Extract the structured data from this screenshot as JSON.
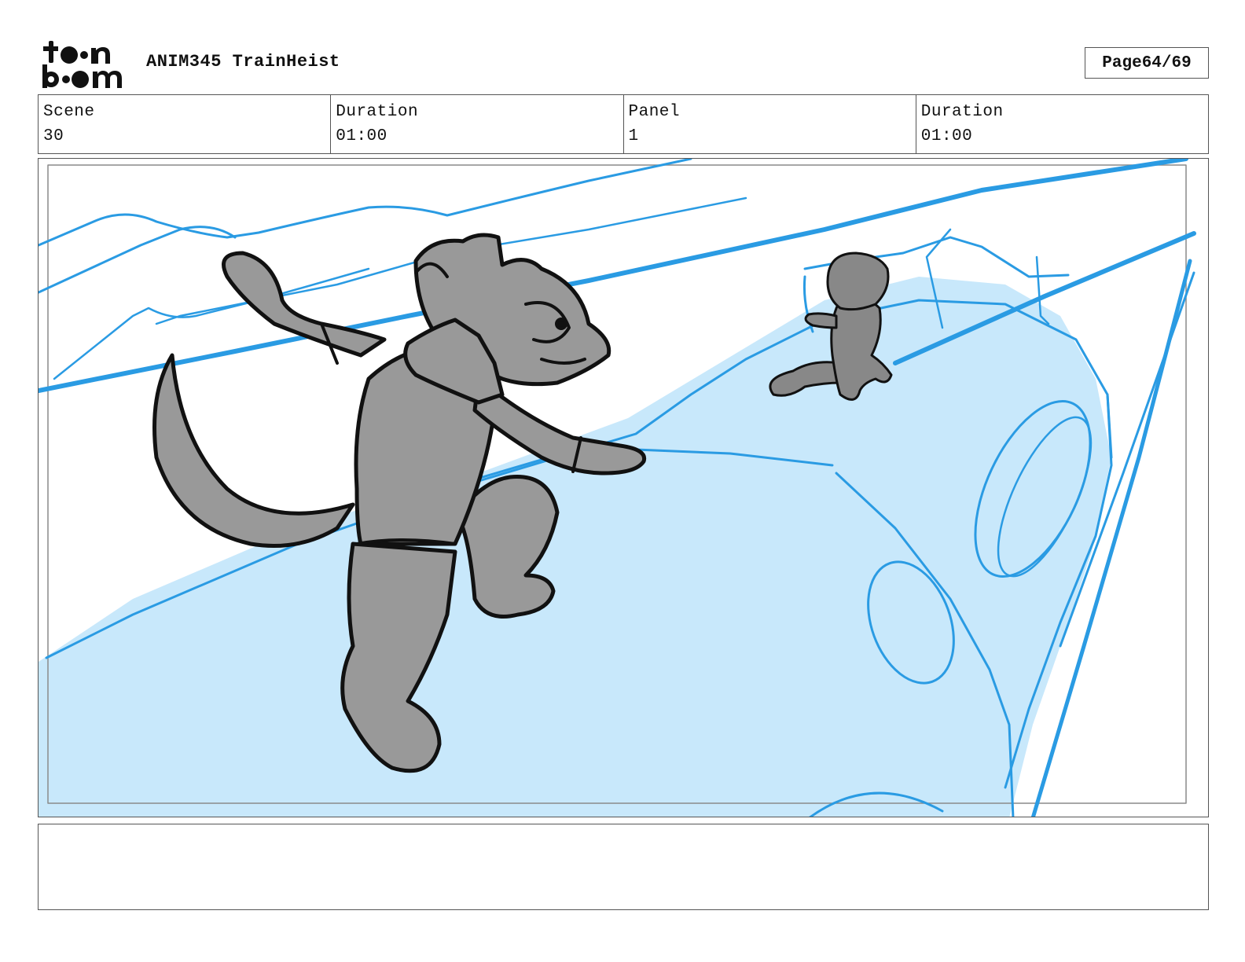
{
  "header": {
    "logo_text": "toon boom",
    "project_title": "ANIM345 TrainHeist",
    "page_label": "Page",
    "page_value": "64/69"
  },
  "info": {
    "scene_label": "Scene",
    "scene_value": "30",
    "scene_duration_label": "Duration",
    "scene_duration_value": "01:00",
    "panel_label": "Panel",
    "panel_value": "1",
    "panel_duration_label": "Duration",
    "panel_duration_value": "01:00"
  },
  "panel": {
    "colors": {
      "sketch_blue": "#2a9be3",
      "ice_fill": "#c8e8fb",
      "character_gray": "#999999",
      "outline": "#111111"
    }
  },
  "notes": {
    "text": ""
  }
}
